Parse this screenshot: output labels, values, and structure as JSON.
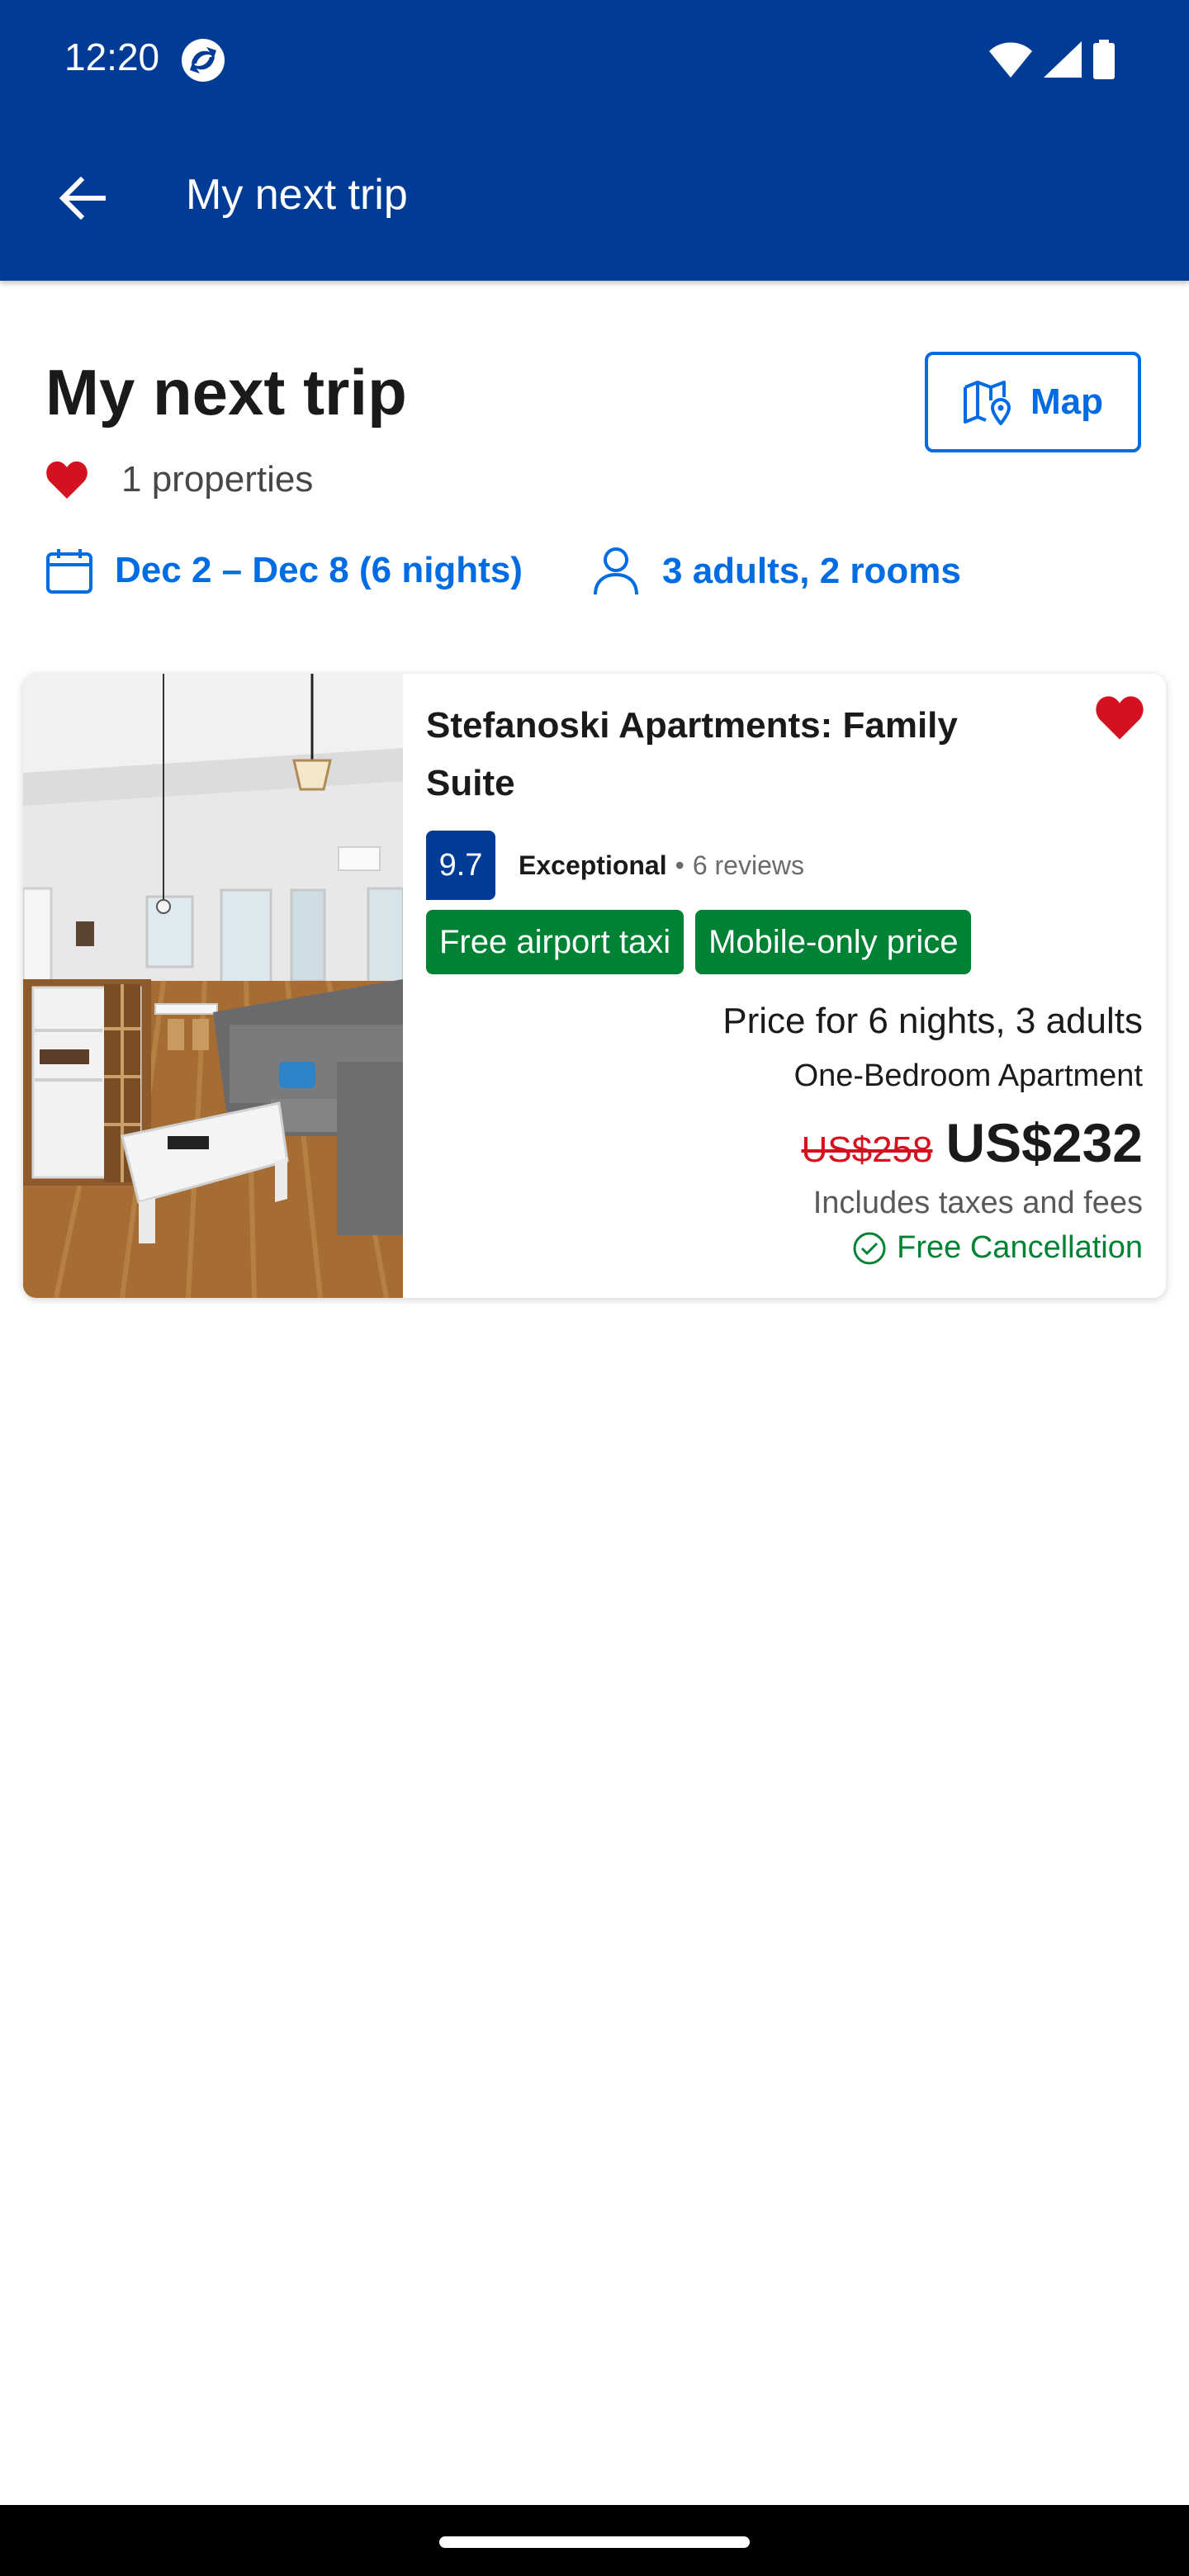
{
  "status_bar": {
    "time": "12:20"
  },
  "app_bar": {
    "title": "My next trip"
  },
  "header": {
    "title": "My next trip",
    "map_label": "Map",
    "saved_count": "1 properties"
  },
  "search": {
    "dates": "Dec 2 – Dec 8 (6 nights)",
    "guests": "3 adults, 2 rooms"
  },
  "property": {
    "name": "Stefanoski Apartments: Family Suite",
    "score": "9.7",
    "score_word": "Exceptional",
    "separator": "•",
    "reviews": "6 reviews",
    "badges": [
      "Free airport taxi",
      "Mobile-only price"
    ],
    "price_for": "Price for 6 nights, 3 adults",
    "room_type": "One-Bedroom Apartment",
    "old_price": "US$258",
    "price": "US$232",
    "taxes": "Includes taxes and fees",
    "cancellation": "Free Cancellation",
    "photo_icon": "apartment-photo"
  },
  "colors": {
    "brand_blue": "#003b95",
    "link_blue": "#006ce4",
    "heart_red": "#d4111e",
    "green": "#008234"
  }
}
